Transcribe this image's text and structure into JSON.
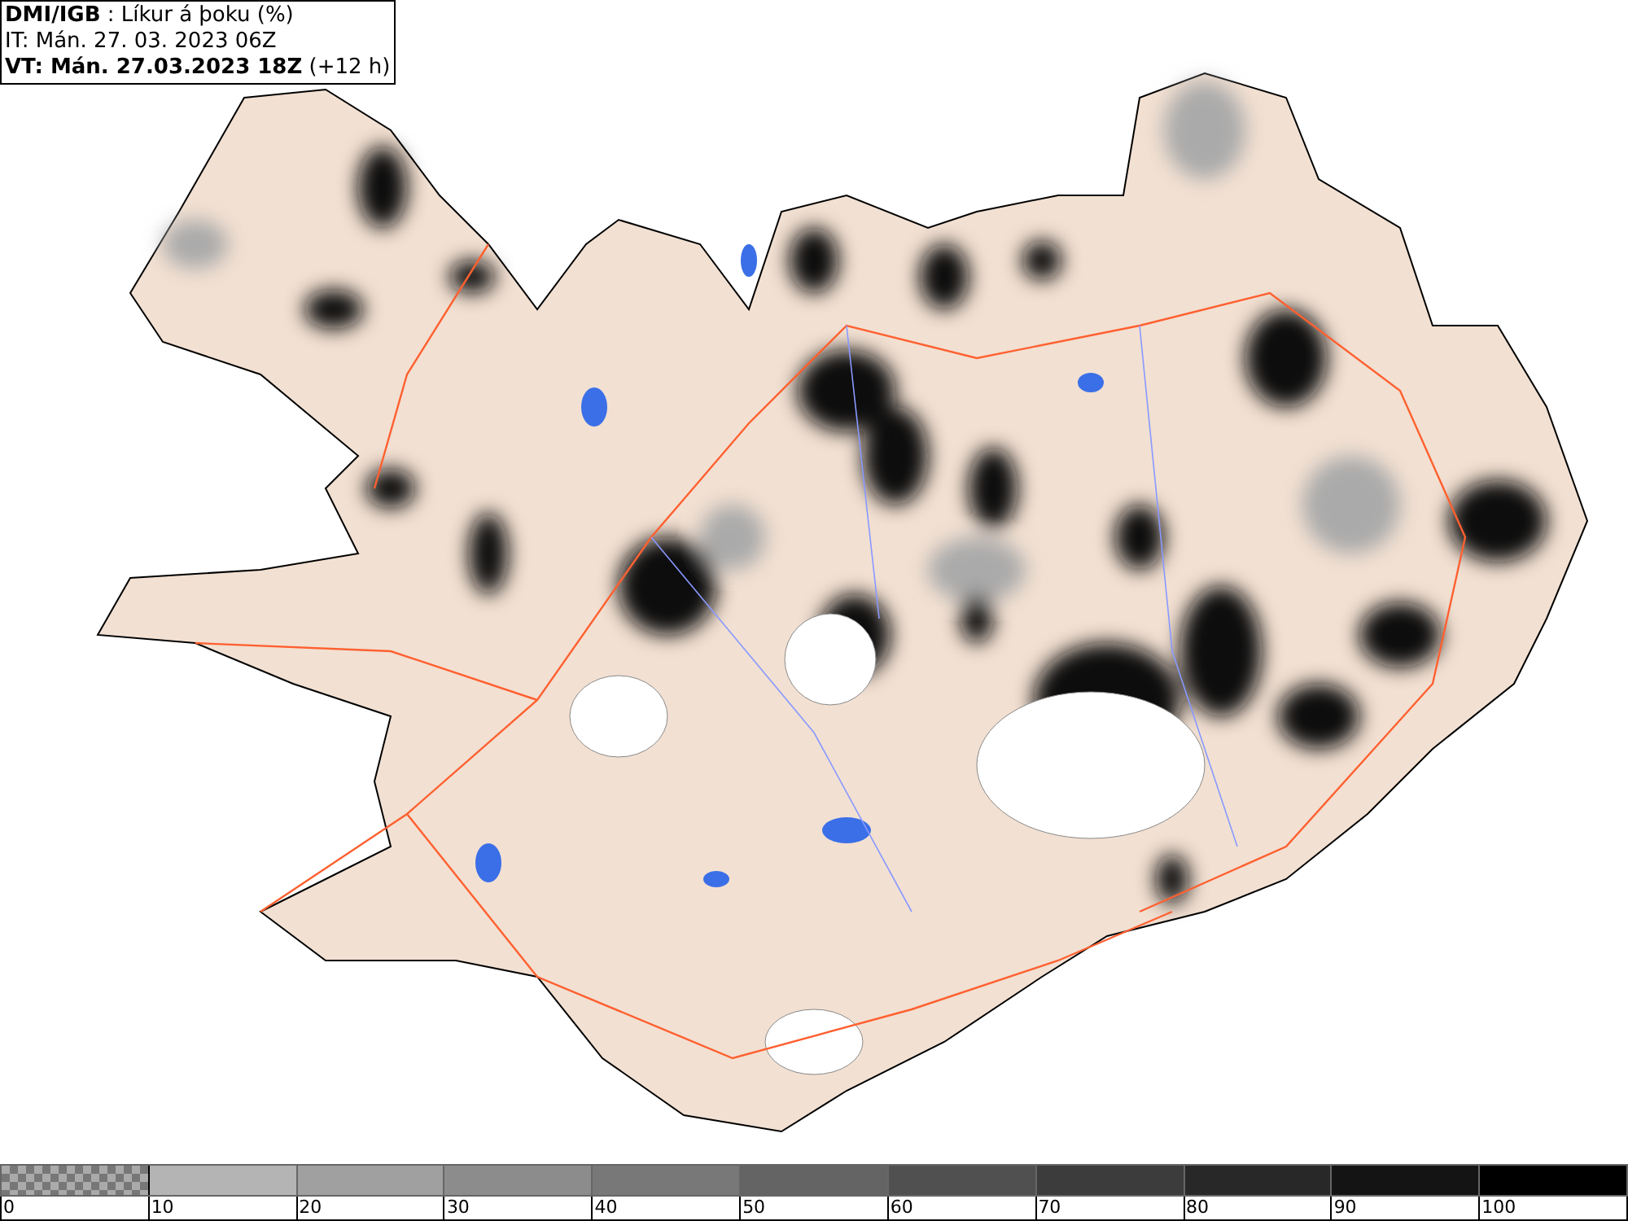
{
  "header": {
    "lines": [
      "**DMI/IGB** : Líkur á þoku (%)",
      "IT: Mán. 27. 03. 2023 06Z",
      "**VT: Mán. 27.03.2023 18Z** (+12 h)"
    ]
  },
  "legend": {
    "segments": [
      {
        "kind": "transparent",
        "label": "0"
      },
      {
        "kind": "solid",
        "color": "#b4b4b4",
        "label": "10"
      },
      {
        "kind": "solid",
        "color": "#a0a0a0",
        "label": "20"
      },
      {
        "kind": "solid",
        "color": "#8c8c8c",
        "label": "30"
      },
      {
        "kind": "solid",
        "color": "#787878",
        "label": "40"
      },
      {
        "kind": "solid",
        "color": "#646464",
        "label": "50"
      },
      {
        "kind": "solid",
        "color": "#505050",
        "label": "60"
      },
      {
        "kind": "solid",
        "color": "#3c3c3c",
        "label": "70"
      },
      {
        "kind": "solid",
        "color": "#282828",
        "label": "80"
      },
      {
        "kind": "solid",
        "color": "#141414",
        "label": "90"
      },
      {
        "kind": "solid",
        "color": "#000000",
        "label": "100"
      }
    ]
  }
}
